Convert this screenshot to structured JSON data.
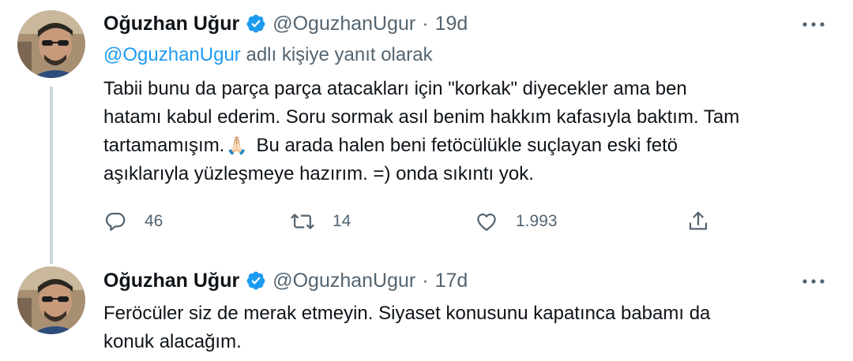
{
  "tweets": [
    {
      "author": {
        "display_name": "Oğuzhan Uğur",
        "handle": "@OguzhanUgur",
        "verified_icon": "verified-badge-icon",
        "avatar_icon": "avatar-photo"
      },
      "separator": "·",
      "time": "19d",
      "reply_to": {
        "mention": "@OguzhanUgur",
        "suffix": " adlı kişiye yanıt olarak"
      },
      "text_lines": [
        "Tabii bunu da parça parça atacakları için \"korkak\" diyecekler ama ben",
        "hatamı kabul ederim. Soru sormak asıl benim hakkım kafasıyla baktım. Tam",
        "tartamamışım.",
        "🙏🏻",
        "Bu arada halen beni fetöcülükle suçlayan eski fetö",
        "aşıklarıyla yüzleşmeye hazırım. =) onda sıkıntı yok."
      ],
      "stats": {
        "replies": "46",
        "retweets": "14",
        "likes": "1.993"
      },
      "icons": {
        "reply": "reply-icon",
        "retweet": "retweet-icon",
        "like": "heart-icon",
        "share": "share-icon",
        "more": "more-options-icon"
      }
    },
    {
      "author": {
        "display_name": "Oğuzhan Uğur",
        "handle": "@OguzhanUgur",
        "verified_icon": "verified-badge-icon",
        "avatar_icon": "avatar-photo"
      },
      "separator": "·",
      "time": "17d",
      "text_lines": [
        "Feröcüler siz de merak etmeyin. Siyaset konusunu kapatınca babamı da",
        "konuk alacağım."
      ]
    }
  ],
  "colors": {
    "accent": "#1d9bf0",
    "secondary_text": "#536471",
    "primary_text": "#0f1419",
    "thread_line": "#cfd9de"
  }
}
